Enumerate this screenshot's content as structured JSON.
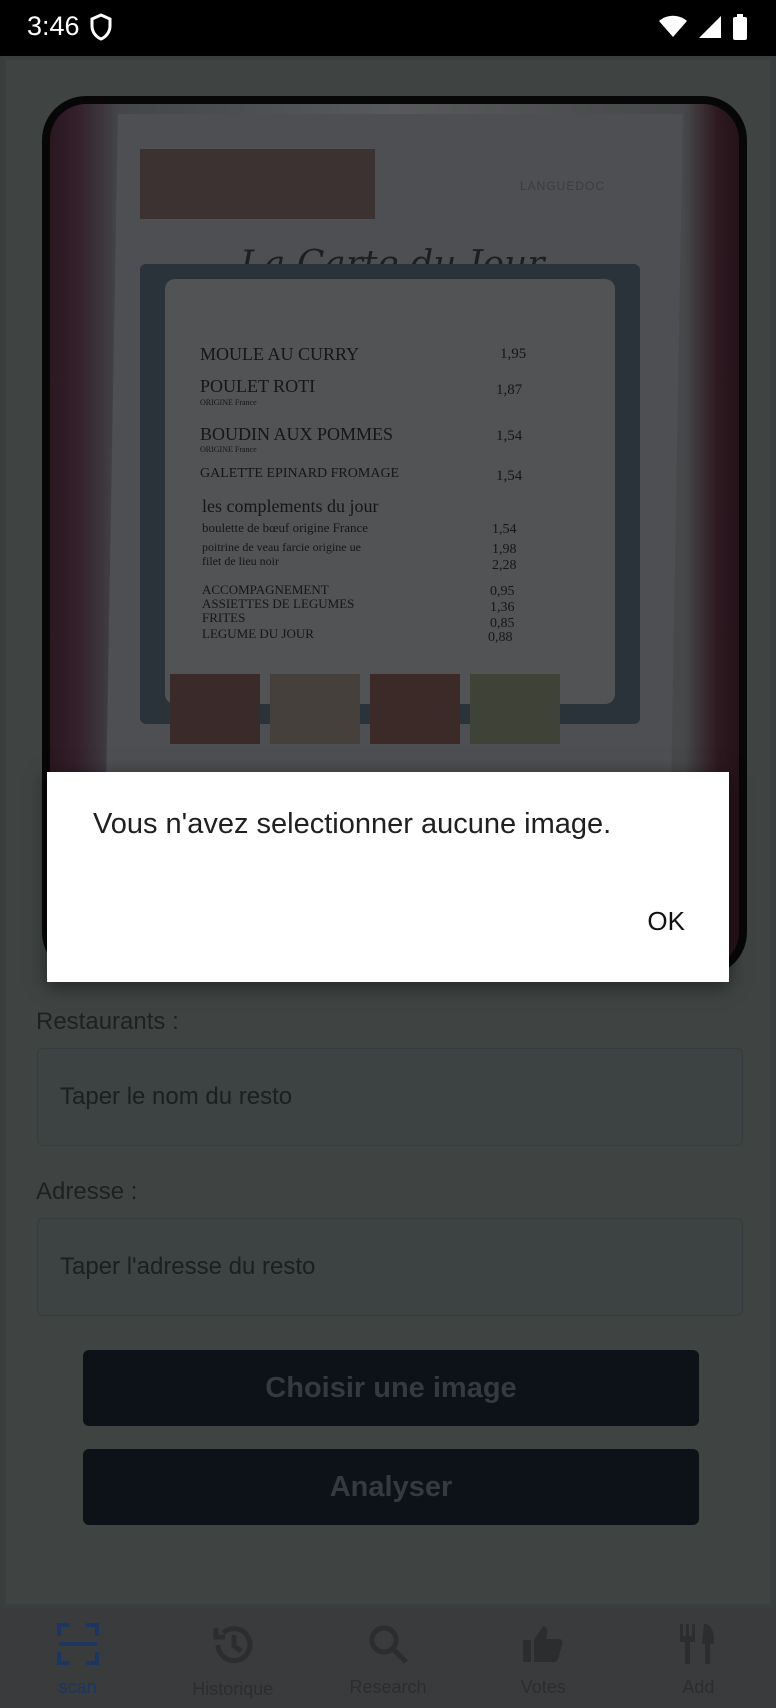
{
  "status_bar": {
    "time": "3:46"
  },
  "menu_image": {
    "brand": "LANGUEDOC",
    "title": "La Carte du Jour",
    "items": [
      {
        "name": "MOULE AU CURRY",
        "price": "1,95"
      },
      {
        "name": "POULET ROTI",
        "sub": "ORIGINE France",
        "price": "1,87"
      },
      {
        "name": "BOUDIN AUX POMMES",
        "sub": "ORIGINE France",
        "price": "1,54"
      },
      {
        "name": "GALETTE EPINARD FROMAGE",
        "price": "1,54"
      }
    ],
    "complements_title": "les complements du jour",
    "complements": [
      {
        "name": "boulette de bœuf origine France",
        "price": "1,54"
      },
      {
        "name": "poitrine de veau farcie origine ue",
        "price": "1,98"
      },
      {
        "name": "filet de lieu noir",
        "price": "2,28"
      }
    ],
    "sides": [
      {
        "name": "ACCOMPAGNEMENT",
        "price": "0,95"
      },
      {
        "name": "ASSIETTES DE LEGUMES",
        "price": "1,36"
      },
      {
        "name": "FRITES",
        "price": "0,85"
      },
      {
        "name": "LEGUME DU JOUR",
        "price": "0,88"
      }
    ]
  },
  "form": {
    "restaurant_label": "Restaurants :",
    "restaurant_placeholder": "Taper le nom du resto",
    "address_label": "Adresse :",
    "address_placeholder": "Taper l'adresse du resto",
    "choose_image_button": "Choisir une image",
    "analyze_button": "Analyser"
  },
  "bottom_nav": {
    "items": [
      {
        "label": "scan",
        "icon": "scan-icon",
        "active": true
      },
      {
        "label": "Historique",
        "icon": "history-icon"
      },
      {
        "label": "Research",
        "icon": "search-icon"
      },
      {
        "label": "Votes",
        "icon": "thumbs-up-icon"
      },
      {
        "label": "Add",
        "icon": "restaurant-icon"
      }
    ]
  },
  "dialog": {
    "message": "Vous n'avez selectionner aucune image.",
    "ok_button": "OK"
  },
  "colors": {
    "active_nav": "#1b3660",
    "dialog_bg": "#ffffff",
    "overlay": "#3f4443"
  }
}
